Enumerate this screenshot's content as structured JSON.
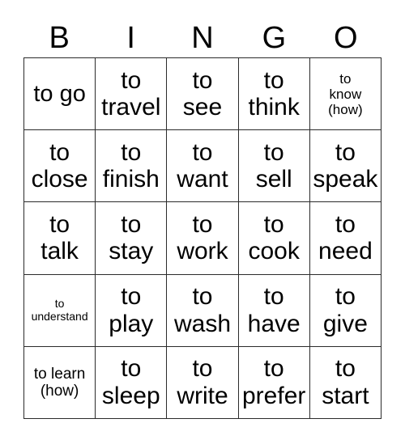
{
  "card": {
    "title": "BINGO",
    "headers": [
      "B",
      "I",
      "N",
      "G",
      "O"
    ],
    "rows": [
      [
        {
          "text": "to go",
          "size": "wide"
        },
        {
          "text": "to\ntravel",
          "size": "xl"
        },
        {
          "text": "to\nsee",
          "size": "xl"
        },
        {
          "text": "to\nthink",
          "size": "xl"
        },
        {
          "text": "to\nknow\n(how)",
          "size": "sm"
        }
      ],
      [
        {
          "text": "to\nclose",
          "size": "xl"
        },
        {
          "text": "to\nfinish",
          "size": "xl"
        },
        {
          "text": "to\nwant",
          "size": "xl"
        },
        {
          "text": "to\nsell",
          "size": "xl"
        },
        {
          "text": "to\nspeak",
          "size": "xl"
        }
      ],
      [
        {
          "text": "to\ntalk",
          "size": "xl"
        },
        {
          "text": "to\nstay",
          "size": "xl"
        },
        {
          "text": "to\nwork",
          "size": "xl"
        },
        {
          "text": "to\ncook",
          "size": "xl"
        },
        {
          "text": "to\nneed",
          "size": "xl"
        }
      ],
      [
        {
          "text": "to\nunderstand",
          "size": "xs"
        },
        {
          "text": "to\nplay",
          "size": "xl"
        },
        {
          "text": "to\nwash",
          "size": "xl"
        },
        {
          "text": "to\nhave",
          "size": "xl"
        },
        {
          "text": "to\ngive",
          "size": "xl"
        }
      ],
      [
        {
          "text": "to learn\n(how)",
          "size": "md"
        },
        {
          "text": "to\nsleep",
          "size": "xl"
        },
        {
          "text": "to\nwrite",
          "size": "xl"
        },
        {
          "text": "to\nprefer",
          "size": "xl"
        },
        {
          "text": "to\nstart",
          "size": "xl"
        }
      ]
    ],
    "colors": {
      "text": "#000000",
      "border": "#2b2b2b",
      "background": "#ffffff"
    }
  }
}
